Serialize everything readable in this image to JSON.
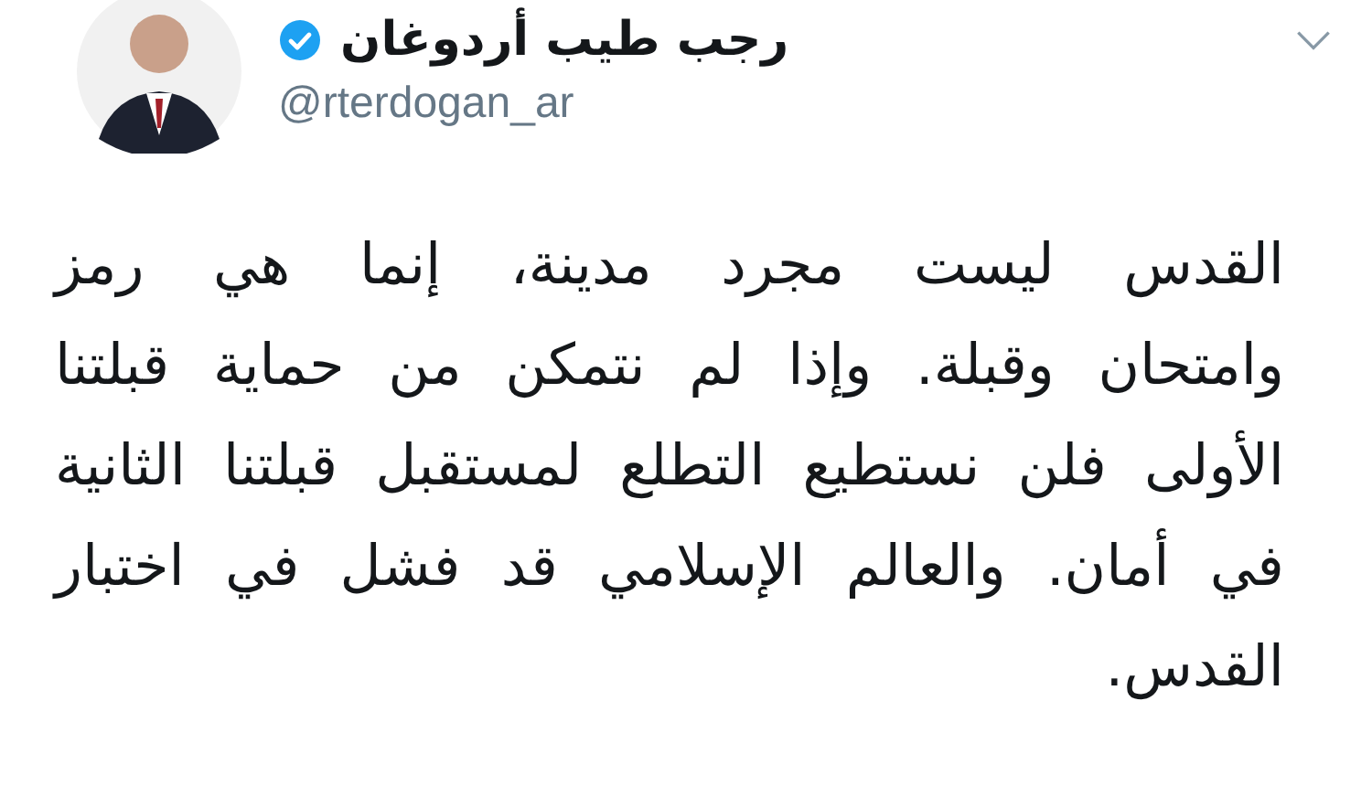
{
  "author": {
    "name": "رجب طيب أردوغان",
    "verified": true,
    "handle": "@rterdogan_ar"
  },
  "tweet": {
    "lines": [
      "القدس ليست مجرد مدينة، إنما هي رمز",
      "وامتحان وقبلة. وإذا لم نتمكن من حماية قبلتنا",
      "الأولى فلن نستطيع التطلع لمستقبل قبلتنا الثانية",
      "في أمان. والعالم الإسلامي قد فشل في اختبار",
      "القدس."
    ]
  }
}
